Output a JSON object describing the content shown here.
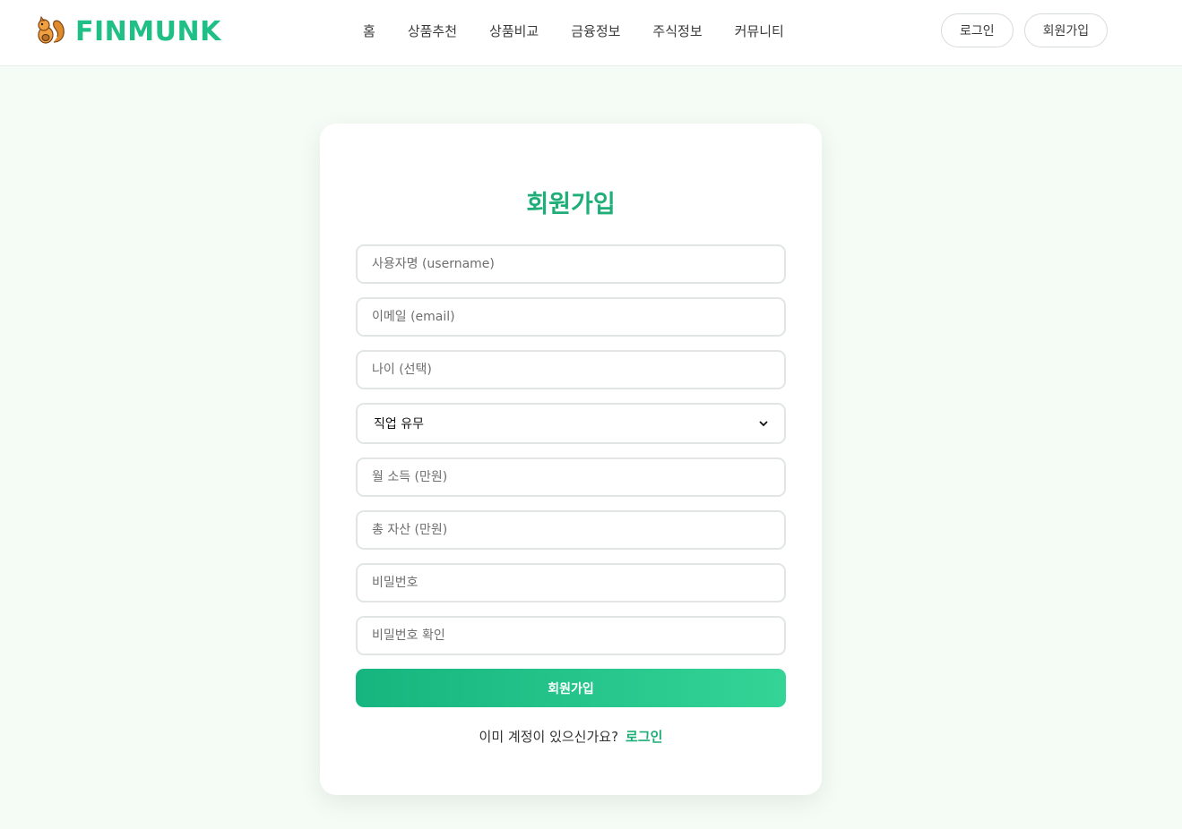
{
  "brand": {
    "name": "FINMUNK",
    "icon": "squirrel-icon",
    "color": "#1fbf86"
  },
  "nav": {
    "items": [
      "홈",
      "상품추천",
      "상품비교",
      "금융정보",
      "주식정보",
      "커뮤니티"
    ]
  },
  "auth": {
    "login_label": "로그인",
    "signup_label": "회원가입"
  },
  "form": {
    "title": "회원가입",
    "fields": {
      "username_placeholder": "사용자명 (username)",
      "email_placeholder": "이메일 (email)",
      "age_placeholder": "나이 (선택)",
      "job_select_value": "직업 유무",
      "income_placeholder": "월 소득 (만원)",
      "assets_placeholder": "총 자산 (만원)",
      "password_placeholder": "비밀번호",
      "password_confirm_placeholder": "비밀번호 확인"
    },
    "submit_label": "회원가입",
    "login_prompt": "이미 계정이 있으신가요?",
    "login_link": "로그인"
  },
  "colors": {
    "accent": "#1fae78",
    "page_bg": "#f5fcf5"
  }
}
